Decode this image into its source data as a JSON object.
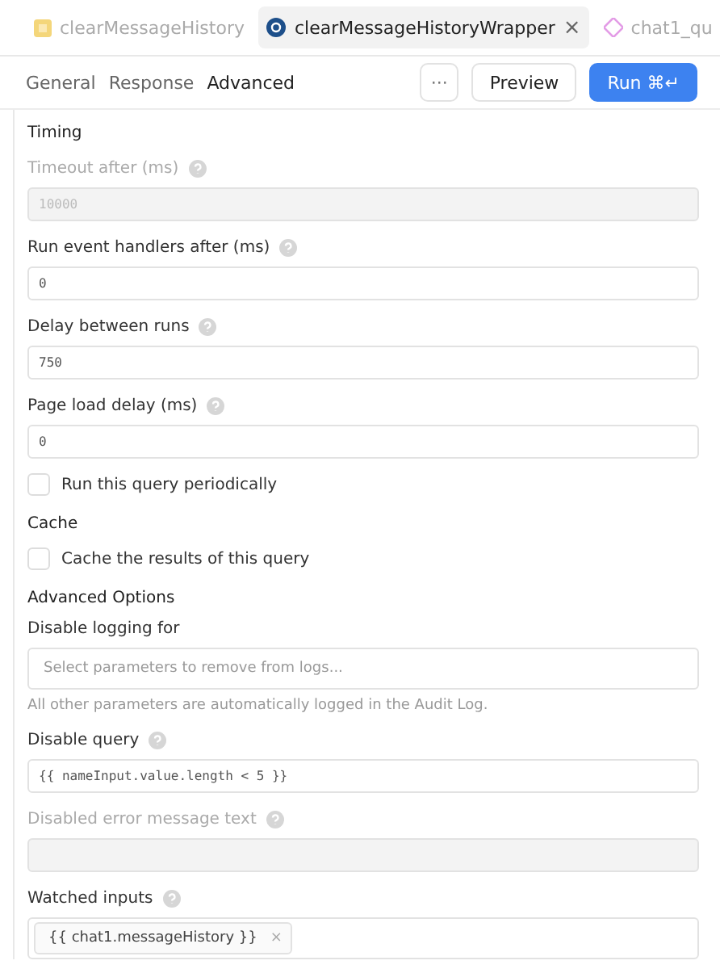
{
  "query_tabs": [
    {
      "label": "clearMessageHistory",
      "selected": false
    },
    {
      "label": "clearMessageHistoryWrapper",
      "selected": true,
      "close": "×"
    },
    {
      "label": "chat1_qu",
      "selected": false
    }
  ],
  "sub_tabs": [
    {
      "label": "General",
      "selected": false
    },
    {
      "label": "Response",
      "selected": false
    },
    {
      "label": "Advanced",
      "selected": true
    }
  ],
  "actions": {
    "more": "···",
    "preview": "Preview",
    "run": "Run ⌘↵"
  },
  "items": [
    {
      "kind": "section",
      "label": "Timing"
    },
    {
      "kind": "field",
      "label": "Timeout after (ms)",
      "help": true,
      "disabled": true,
      "value": "10000"
    },
    {
      "kind": "field",
      "label": "Run event handlers after (ms)",
      "help": true,
      "disabled": false,
      "value": "0"
    },
    {
      "kind": "field",
      "label": "Delay between runs",
      "help": true,
      "disabled": false,
      "value": "750"
    },
    {
      "kind": "field",
      "label": "Page load delay (ms)",
      "help": true,
      "disabled": false,
      "value": "0"
    },
    {
      "kind": "checkbox",
      "label": "Run this query periodically",
      "checked": false
    },
    {
      "kind": "section",
      "label": "Cache"
    },
    {
      "kind": "checkbox",
      "label": "Cache the results of this query",
      "checked": false
    },
    {
      "kind": "section",
      "label": "Advanced Options"
    },
    {
      "kind": "select",
      "label": "Disable logging for",
      "placeholder": "Select parameters to remove from logs..."
    },
    {
      "kind": "hint",
      "label": "All other parameters are automatically logged in the Audit Log."
    },
    {
      "kind": "field",
      "label": "Disable query",
      "help": true,
      "disabled": false,
      "value": "{{ nameInput.value.length < 5 }}"
    },
    {
      "kind": "field",
      "label": "Disabled error message text",
      "help": true,
      "disabled": true,
      "value": ""
    },
    {
      "kind": "tags",
      "label": "Watched inputs",
      "help": true,
      "tags": [
        {
          "label": "{{ chat1.messageHistory }}",
          "remove": "×"
        }
      ]
    }
  ]
}
